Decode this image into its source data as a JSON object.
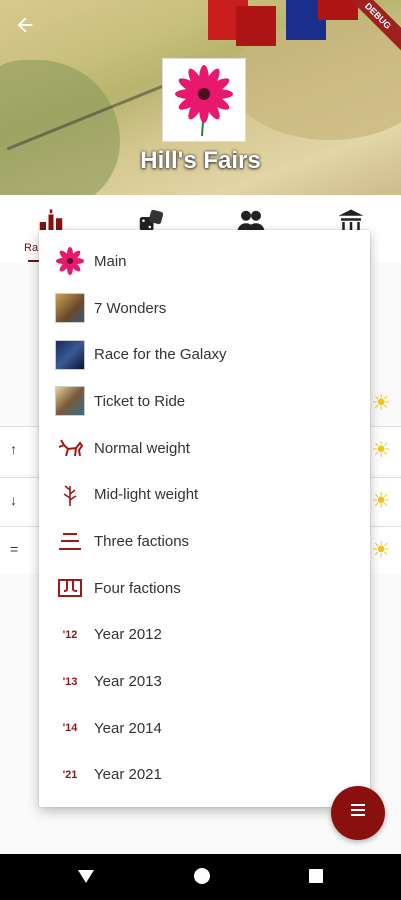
{
  "header": {
    "back_icon": "arrow-left-icon",
    "debug_banner": "DEBUG",
    "title": "Hill's Fairs"
  },
  "tabs": {
    "items": [
      {
        "icon": "podium-icon",
        "label": "Ra"
      },
      {
        "icon": "dice-icon"
      },
      {
        "icon": "people-icon"
      },
      {
        "icon": "temple-icon"
      }
    ]
  },
  "background_rows": [
    {
      "arrow": "",
      "icon": "sun-icon"
    },
    {
      "arrow": "↑",
      "icon": "sun-icon"
    },
    {
      "arrow": "↓",
      "icon": "sun-icon"
    },
    {
      "arrow": "=",
      "icon": "sun-icon"
    }
  ],
  "menu": {
    "items": [
      {
        "label": "Main",
        "icon": "flower-icon"
      },
      {
        "label": "7 Wonders",
        "icon": "game-box-icon"
      },
      {
        "label": "Race for the Galaxy",
        "icon": "game-box-icon"
      },
      {
        "label": "Ticket to Ride",
        "icon": "game-box-icon"
      },
      {
        "label": "Normal weight",
        "icon": "animal-icon"
      },
      {
        "label": "Mid-light weight",
        "icon": "feather-icon"
      },
      {
        "label": "Three factions",
        "icon": "three-icon"
      },
      {
        "label": "Four factions",
        "icon": "four-icon"
      },
      {
        "label": "Year 2012",
        "badge": "'12"
      },
      {
        "label": "Year 2013",
        "badge": "'13"
      },
      {
        "label": "Year 2014",
        "badge": "'14"
      },
      {
        "label": "Year 2021",
        "badge": "'21"
      }
    ]
  },
  "fab": {
    "icon": "menu-icon"
  },
  "navbar": {
    "back": "back-triangle-icon",
    "home": "home-circle-icon",
    "recents": "recents-square-icon"
  }
}
